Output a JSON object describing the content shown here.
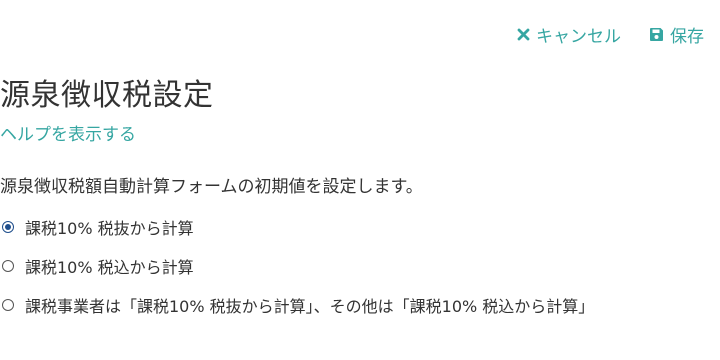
{
  "toolbar": {
    "cancel_label": "キャンセル",
    "save_label": "保存",
    "accent_color": "#36a6a2"
  },
  "page": {
    "title": "源泉徴収税設定",
    "help_link": "ヘルプを表示する",
    "description": "源泉徴収税額自動計算フォームの初期値を設定します。"
  },
  "options": {
    "selected_index": 0,
    "items": [
      {
        "label": "課税10% 税抜から計算",
        "checked": true
      },
      {
        "label": "課税10% 税込から計算",
        "checked": false
      },
      {
        "label": "課税事業者は「課税10% 税抜から計算」、その他は「課税10% 税込から計算」",
        "checked": false
      }
    ]
  },
  "icons": {
    "cancel": "close-icon",
    "save": "floppy-disk-icon"
  }
}
